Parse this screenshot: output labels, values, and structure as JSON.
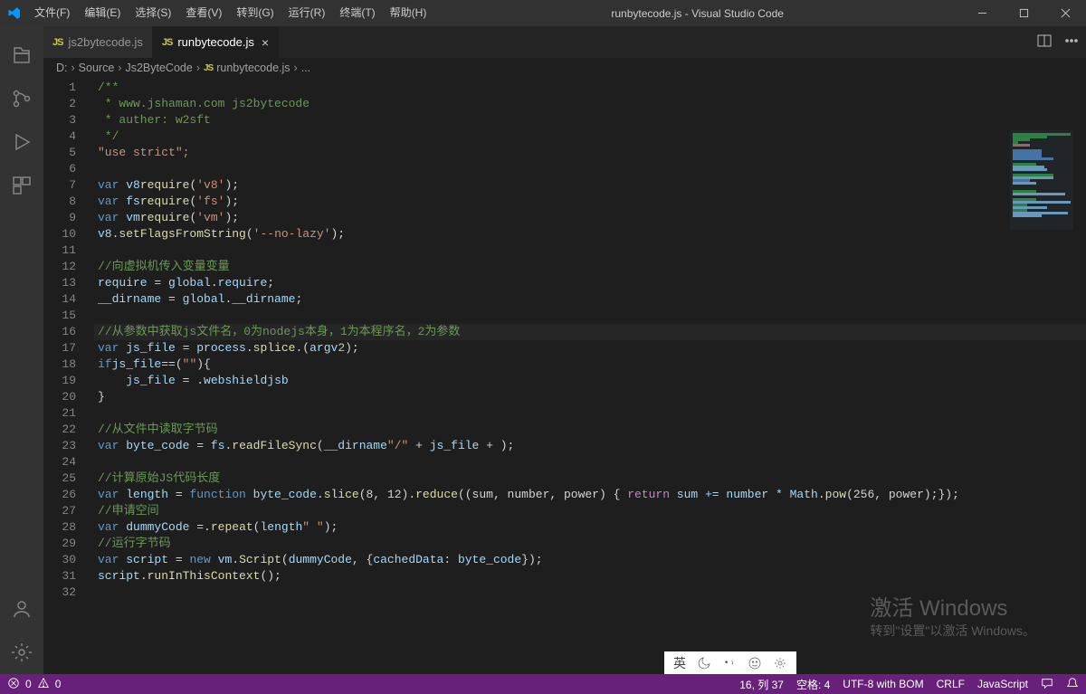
{
  "window": {
    "title": "runbytecode.js - Visual Studio Code"
  },
  "menu": {
    "file": "文件(F)",
    "edit": "编辑(E)",
    "select": "选择(S)",
    "view": "查看(V)",
    "go": "转到(G)",
    "run": "运行(R)",
    "terminal": "终端(T)",
    "help": "帮助(H)"
  },
  "tabs": {
    "tab1": {
      "icon": "JS",
      "label": "js2bytecode.js"
    },
    "tab2": {
      "icon": "JS",
      "label": "runbytecode.js"
    }
  },
  "breadcrumbs": {
    "p0": "D:",
    "p1": "Source",
    "p2": "Js2ByteCode",
    "p3_icon": "JS",
    "p3": "runbytecode.js",
    "p4": "..."
  },
  "code": {
    "line_count": 32,
    "lines": {
      "l1": "/**",
      "l2": " * www.jshaman.com js2bytecode",
      "l3": " * auther: w2sft",
      "l4": " */",
      "l5": "\"use strict\";",
      "l6": "",
      "l7": {
        "kw": "var ",
        "id": "v8",
        " op": " = ",
        "fn": "require",
        "paren": "(",
        "str": "'v8'",
        "rest": ");"
      },
      "l8": {
        "kw": "var ",
        "id": "fs",
        " op": " = ",
        "fn": "require",
        "paren": "(",
        "str": "'fs'",
        "rest": ");"
      },
      "l9": {
        "kw": "var ",
        "id": "vm",
        " op": " = ",
        "fn": "require",
        "paren": "(",
        "str": "'vm'",
        "rest": ");"
      },
      "l10": {
        "obj": "v8",
        "dot": ".",
        "fn": "setFlagsFromString",
        "paren": "(",
        "str": "'--no-lazy'",
        "rest": ");"
      },
      "l11": "",
      "l12": "//向虚拟机传入变量变量",
      "l13": {
        "obj": "global",
        "dot": ".",
        "id": "require",
        "op": " = ",
        "id2": "require",
        "rest": ";"
      },
      "l14": {
        "obj": "global",
        "dot": ".",
        "id": "__dirname",
        "op": " = ",
        "id2": "__dirname",
        "rest": ";"
      },
      "l15": "",
      "l16": "//从参数中获取js文件名，0为nodejs本身，1为本程序名，2为参数",
      "l17": {
        "kw": "var ",
        "id": "js_file",
        "op": " = ",
        "obj": "process",
        "dot": ".",
        "id2": "argv",
        "dot2": ".",
        "fn": "splice",
        "paren": "(",
        "num": "2",
        "rest": ");"
      },
      "l18": {
        "kw": "if",
        "paren": "(",
        "id": "js_file",
        "op": "==",
        "str": "\"\"",
        "rest": "){"
      },
      "l19": {
        "indent": "    ",
        "id": "js_file",
        "op": " = ",
        "id2": "webshield",
        "dot": ".",
        "id3": "jsb"
      },
      "l20": "}",
      "l21": "",
      "l22": "//从文件中读取字节码",
      "l23": {
        "kw": "var ",
        "id": "byte_code",
        "op": " = ",
        "obj": "fs",
        "dot": ".",
        "fn": "readFileSync",
        "paren": "(",
        "id2": "__dirname",
        "op2": " + ",
        "str": "\"/\"",
        "op3": " + ",
        "id3": "js_file",
        "rest": ");"
      },
      "l24": "",
      "l25": "//计算原始JS代码长度",
      "l26": {
        "kw": "var ",
        "id": "length",
        "op": " = ",
        "obj": "byte_code",
        "dot": ".",
        "fn": "slice",
        "args": "(8, 12)",
        "dot2": ".",
        "fn2": "reduce",
        "paren": "(",
        "kw2": "function ",
        "args2": "(sum, number, power) { ",
        "kw3": "return ",
        "expr": "sum += number * ",
        "obj2": "Math",
        "dot3": ".",
        "fn3": "pow",
        "args3": "(256, power);});"
      },
      "l27": "//申请空间",
      "l28": {
        "kw": "var ",
        "id": "dummyCode",
        "op": " =",
        "str": "\" \"",
        "dot": ".",
        "fn": "repeat",
        "paren": "(",
        "id2": "length",
        "rest": ");"
      },
      "l29": "//运行字节码",
      "l30": {
        "kw": "var ",
        "id": "script",
        "op": " = ",
        "kw2": "new ",
        "obj": "vm",
        "dot": ".",
        "fn": "Script",
        "paren": "(",
        "id2": "dummyCode",
        "op2": ", {",
        "id3": "cachedData",
        "op3": ": ",
        "id4": "byte_code",
        "rest": "});"
      },
      "l31": {
        "obj": "script",
        "dot": ".",
        "fn": "runInThisContext",
        "rest": "();"
      },
      "l32": ""
    }
  },
  "status": {
    "errors": "0",
    "warnings": "0",
    "position": "16, 列 37",
    "spaces": "空格: 4",
    "encoding": "UTF-8 with BOM",
    "eol": "CRLF",
    "language": "JavaScript"
  },
  "ime": {
    "lang": "英"
  },
  "watermark": {
    "line1": "激活 Windows",
    "line2": "转到\"设置\"以激活 Windows。"
  }
}
